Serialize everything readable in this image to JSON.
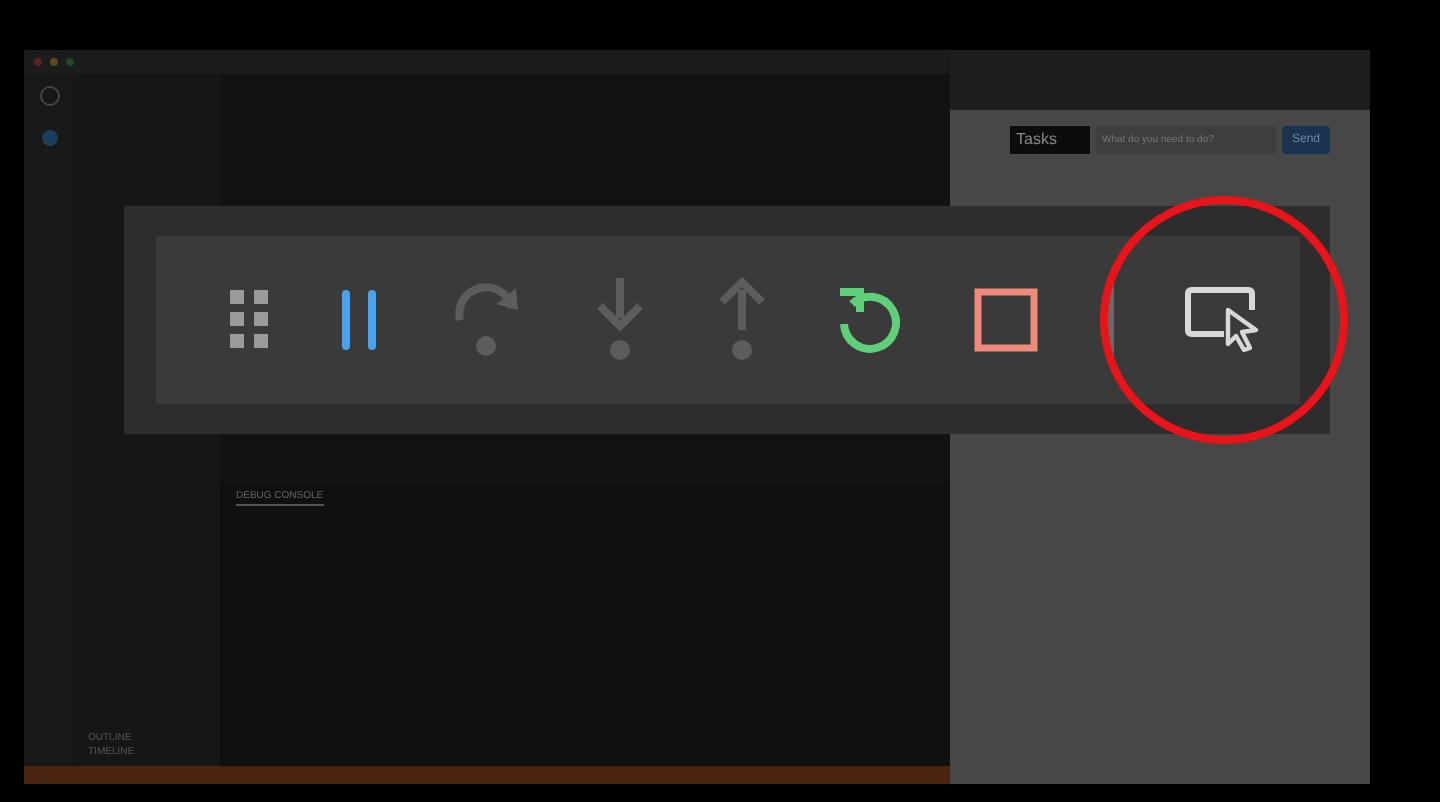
{
  "vscode": {
    "panel_tabs": [
      {
        "label": "DEBUG CONSOLE",
        "selected": true
      }
    ],
    "sidebar_sections": [
      "OUTLINE",
      "TIMELINE"
    ]
  },
  "browser": {
    "tasks_label": "Tasks",
    "input": {
      "placeholder": "What do you need to do?"
    },
    "send_button": "Send"
  },
  "debug_toolbar": {
    "buttons": [
      {
        "kind": "grip",
        "disabled": false,
        "highlighted": false
      },
      {
        "kind": "pause",
        "disabled": false,
        "highlighted": false
      },
      {
        "kind": "step_over",
        "disabled": true,
        "highlighted": false
      },
      {
        "kind": "step_into",
        "disabled": true,
        "highlighted": false
      },
      {
        "kind": "step_out",
        "disabled": true,
        "highlighted": false
      },
      {
        "kind": "restart",
        "disabled": false,
        "highlighted": false
      },
      {
        "kind": "stop",
        "disabled": false,
        "highlighted": false
      },
      {
        "kind": "divider",
        "disabled": false,
        "highlighted": false
      },
      {
        "kind": "inspect",
        "disabled": false,
        "highlighted": true
      }
    ]
  }
}
